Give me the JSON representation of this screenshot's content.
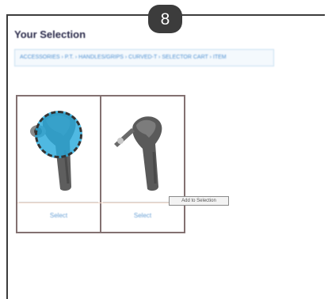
{
  "step": {
    "number": "8"
  },
  "header": {
    "title": "Your Selection"
  },
  "selection_bar": {
    "text": "ACCESSORIES › P.T. › HANDLES/GRIPS › CURVED-T › SELECTOR CART › ITEM"
  },
  "products": [
    {
      "name": "Ergonomic grip handle (blue highlight)",
      "select_label": "Select",
      "icon": "handle-grip-icon"
    },
    {
      "name": "Angled grip handle",
      "select_label": "Select",
      "icon": "handle-grip-icon"
    }
  ],
  "tooltip": {
    "text": "Add to Selection"
  },
  "colors": {
    "badge": "#3c3c3c",
    "highlight": "#28aadc",
    "card_border": "#837171",
    "link": "#6ea3d6",
    "selection_bar_border": "#c7dff0"
  }
}
